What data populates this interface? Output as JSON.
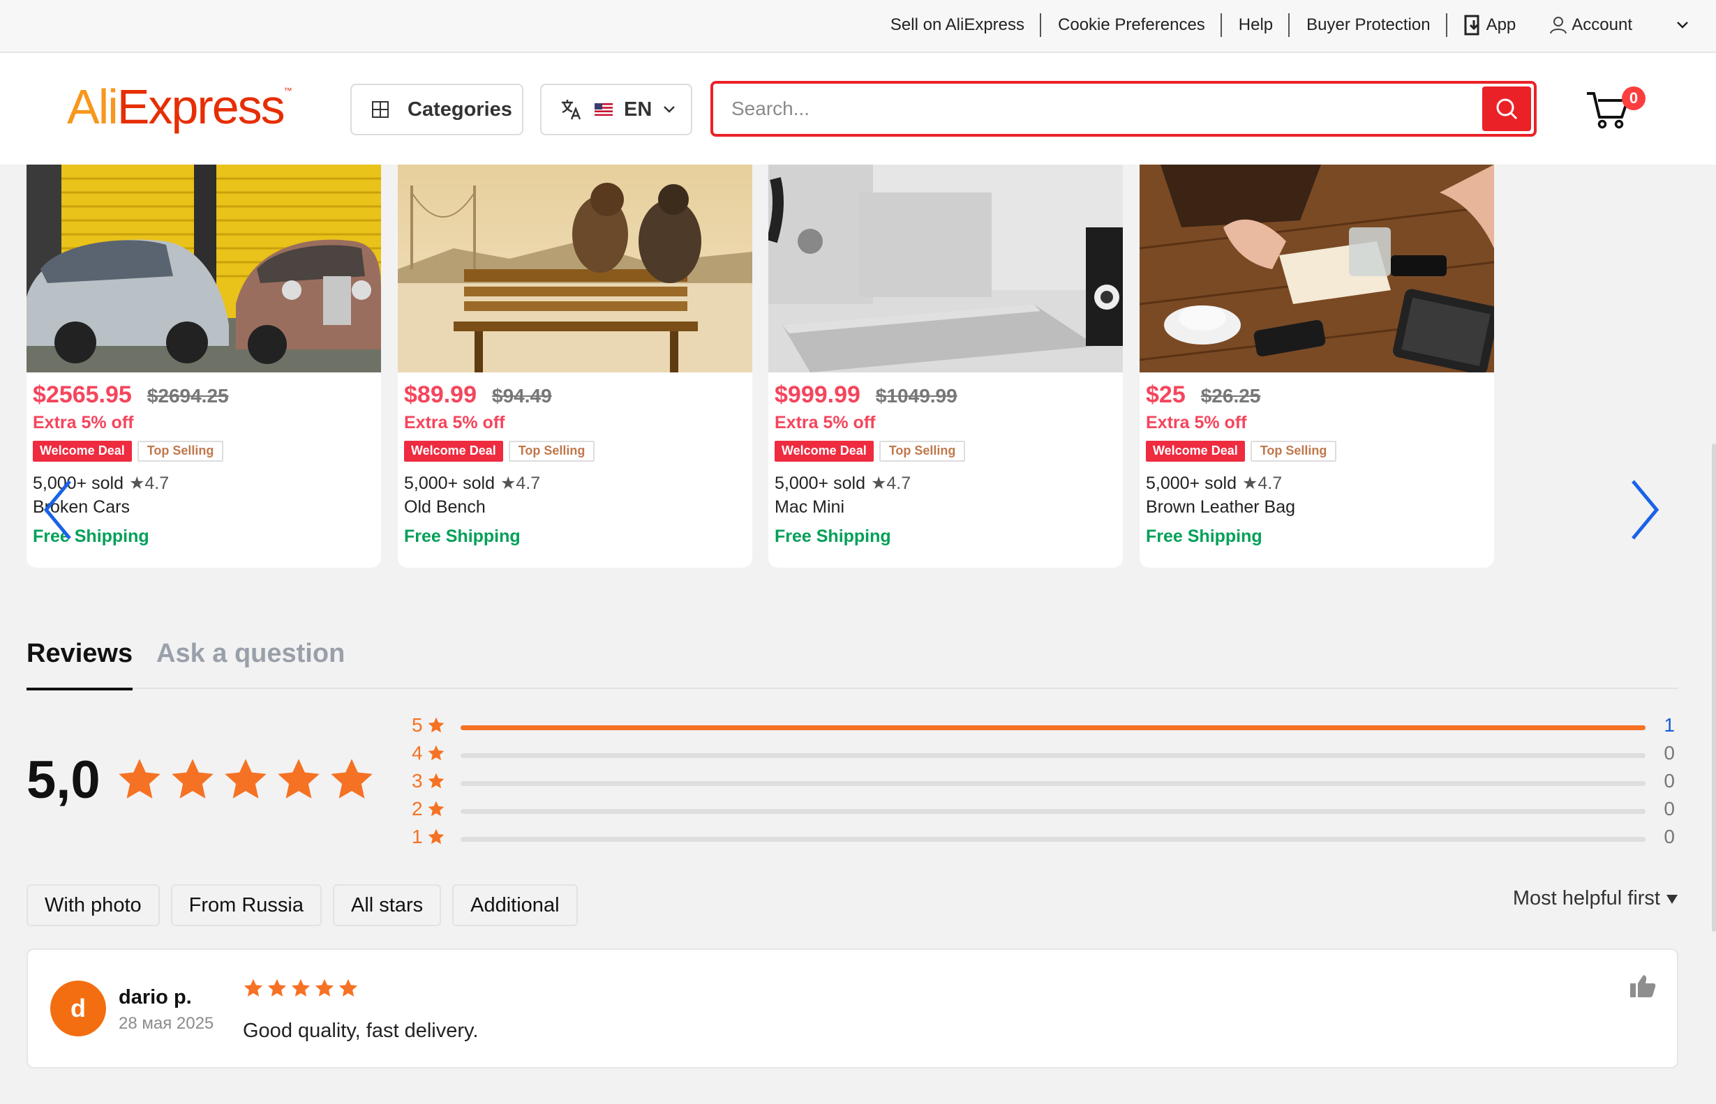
{
  "topbar": {
    "links": [
      "Sell on AliExpress",
      "Cookie Preferences",
      "Help",
      "Buyer Protection"
    ],
    "app_label": "App",
    "account_label": "Account"
  },
  "header": {
    "logo_ali": "Ali",
    "logo_express": "Express",
    "logo_tm": "™",
    "categories_label": "Categories",
    "lang_label": "EN",
    "search_placeholder": "Search...",
    "cart_count": "0"
  },
  "products": [
    {
      "price": "$2565.95",
      "old_price": "$2694.25",
      "extra": "Extra 5% off",
      "badge1": "Welcome Deal",
      "badge2": "Top Selling",
      "sold": "5,000+ sold",
      "rating": "★4.7",
      "name": "Broken Cars",
      "shipping": "Free Shipping",
      "image": "cars"
    },
    {
      "price": "$89.99",
      "old_price": "$94.49",
      "extra": "Extra 5% off",
      "badge1": "Welcome Deal",
      "badge2": "Top Selling",
      "sold": "5,000+ sold",
      "rating": "★4.7",
      "name": "Old Bench",
      "shipping": "Free Shipping",
      "image": "bench"
    },
    {
      "price": "$999.99",
      "old_price": "$1049.99",
      "extra": "Extra 5% off",
      "badge1": "Welcome Deal",
      "badge2": "Top Selling",
      "sold": "5,000+ sold",
      "rating": "★4.7",
      "name": "Mac Mini",
      "shipping": "Free Shipping",
      "image": "mac"
    },
    {
      "price": "$25",
      "old_price": "$26.25",
      "extra": "Extra 5% off",
      "badge1": "Welcome Deal",
      "badge2": "Top Selling",
      "sold": "5,000+ sold",
      "rating": "★4.7",
      "name": "Brown Leather Bag",
      "shipping": "Free Shipping",
      "image": "bag"
    }
  ],
  "reviews": {
    "tabs": [
      "Reviews",
      "Ask a question"
    ],
    "score": "5,0",
    "distribution": [
      {
        "stars": "5",
        "count": "1",
        "fraction": 1.0
      },
      {
        "stars": "4",
        "count": "0",
        "fraction": 0
      },
      {
        "stars": "3",
        "count": "0",
        "fraction": 0
      },
      {
        "stars": "2",
        "count": "0",
        "fraction": 0
      },
      {
        "stars": "1",
        "count": "0",
        "fraction": 0
      }
    ],
    "filters": [
      "With photo",
      "From Russia",
      "All stars",
      "Additional"
    ],
    "sort_label": "Most helpful first",
    "items": [
      {
        "avatar_letter": "d",
        "name": "dario p.",
        "date": "28 мая 2025",
        "stars": 5,
        "text": "Good quality, fast delivery."
      }
    ]
  },
  "colors": {
    "brand_red": "#ea2227",
    "price_red": "#f5455c",
    "star_orange": "#f57224",
    "shipping_green": "#00a058"
  }
}
